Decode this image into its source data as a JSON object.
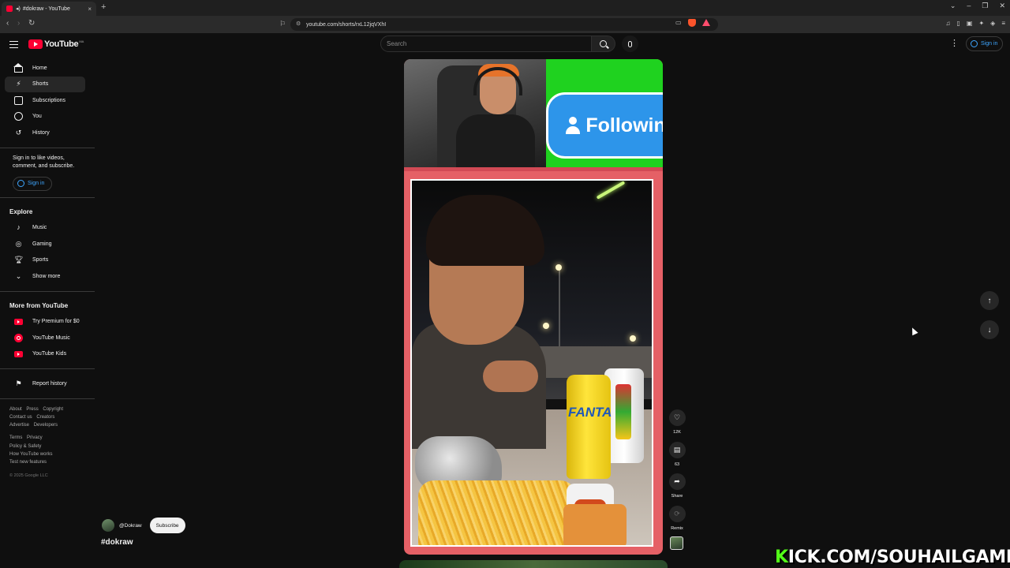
{
  "browser": {
    "tab_title": "#dokraw - YouTube",
    "tab_close": "×",
    "new_tab": "+",
    "url": "youtube.com/shorts/rxL12jqVXhI"
  },
  "header": {
    "logo_text": "YouTube",
    "logo_country": "MA",
    "search_placeholder": "Search",
    "signin_label": "Sign in"
  },
  "sidebar": {
    "main_items": [
      {
        "label": "Home",
        "icon": "home-icon"
      },
      {
        "label": "Shorts",
        "icon": "shorts-icon",
        "active": true
      },
      {
        "label": "Subscriptions",
        "icon": "subscriptions-icon"
      },
      {
        "label": "You",
        "icon": "you-icon"
      },
      {
        "label": "History",
        "icon": "history-icon"
      }
    ],
    "signin_note": "Sign in to like videos, comment, and subscribe.",
    "signin_label": "Sign in",
    "explore_title": "Explore",
    "explore_items": [
      {
        "label": "Music",
        "icon": "music-icon"
      },
      {
        "label": "Gaming",
        "icon": "gaming-icon"
      },
      {
        "label": "Sports",
        "icon": "sports-icon"
      },
      {
        "label": "Show more",
        "icon": "chevron-down-icon"
      }
    ],
    "more_title": "More from YouTube",
    "more_items": [
      {
        "label": "Try Premium for $0",
        "icon": "youtube-premium-icon"
      },
      {
        "label": "YouTube Music",
        "icon": "youtube-music-icon"
      },
      {
        "label": "YouTube Kids",
        "icon": "youtube-kids-icon"
      }
    ],
    "report_label": "Report history",
    "footer_links_1": [
      "About",
      "Press",
      "Copyright",
      "Contact us",
      "Creators",
      "Advertise",
      "Developers"
    ],
    "footer_links_2": [
      "Terms",
      "Privacy",
      "Policy & Safety",
      "How YouTube works",
      "Test new features"
    ],
    "copyright": "© 2025 Google LLC"
  },
  "short": {
    "overlay_text": "Following",
    "can_brand": "FANTA",
    "channel_handle": "@Dokraw",
    "subscribe_label": "Subscribe",
    "title": "#dokraw"
  },
  "actions": [
    {
      "name": "like",
      "icon": "thumbs-up-icon",
      "label": "12K"
    },
    {
      "name": "comments",
      "icon": "comment-icon",
      "label": "63"
    },
    {
      "name": "share",
      "icon": "share-icon",
      "label": "Share"
    },
    {
      "name": "remix",
      "icon": "remix-icon",
      "label": "Remix"
    }
  ],
  "overlay_banner": {
    "prefix": "K",
    "rest": "ICK.COM/SOUHAILGAMING"
  },
  "colors": {
    "brand_red": "#ff0033",
    "link_blue": "#3ea6ff",
    "kick_green": "#53fc18",
    "player_frame": "#e56066"
  }
}
